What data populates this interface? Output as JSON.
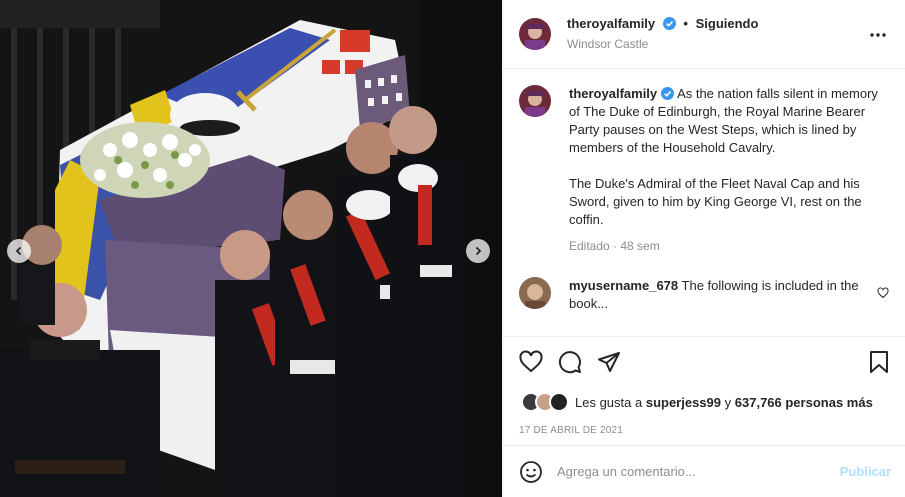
{
  "post": {
    "username": "theroyalfamily",
    "follow_status": "Siguiendo",
    "location": "Windsor Castle",
    "caption": {
      "username": "theroyalfamily",
      "paragraph1": "As the nation falls silent in memory of The Duke of Edinburgh, the Royal Marine Bearer Party pauses on the West Steps, which is lined by members of the Household Cavalry.",
      "paragraph2": "The Duke's Admiral of the Fleet Naval Cap and his Sword, given to him by King George VI, rest on the coffin.",
      "meta": "Editado · 48 sem"
    },
    "comment": {
      "username": "myusername_678",
      "text": "The following is included in the book..."
    },
    "likes": {
      "prefix": "Les gusta a",
      "user": "superjess99",
      "joiner": "y",
      "count": "637,766 personas más"
    },
    "date": "17 DE ABRIL DE 2021",
    "add_comment_placeholder": "Agrega un comentario...",
    "publish_label": "Publicar"
  },
  "icons": {
    "verified": "verified-badge-icon",
    "more": "more-options-icon",
    "like": "heart-icon",
    "comment": "comment-icon",
    "share": "share-icon",
    "save": "bookmark-icon",
    "emoji": "emoji-icon",
    "prev": "chevron-left-icon",
    "next": "chevron-right-icon"
  },
  "colors": {
    "verified": "#3897f0",
    "publish_disabled": "#b2dffc",
    "secondary_text": "#8e8e8e",
    "primary_text": "#262626"
  }
}
